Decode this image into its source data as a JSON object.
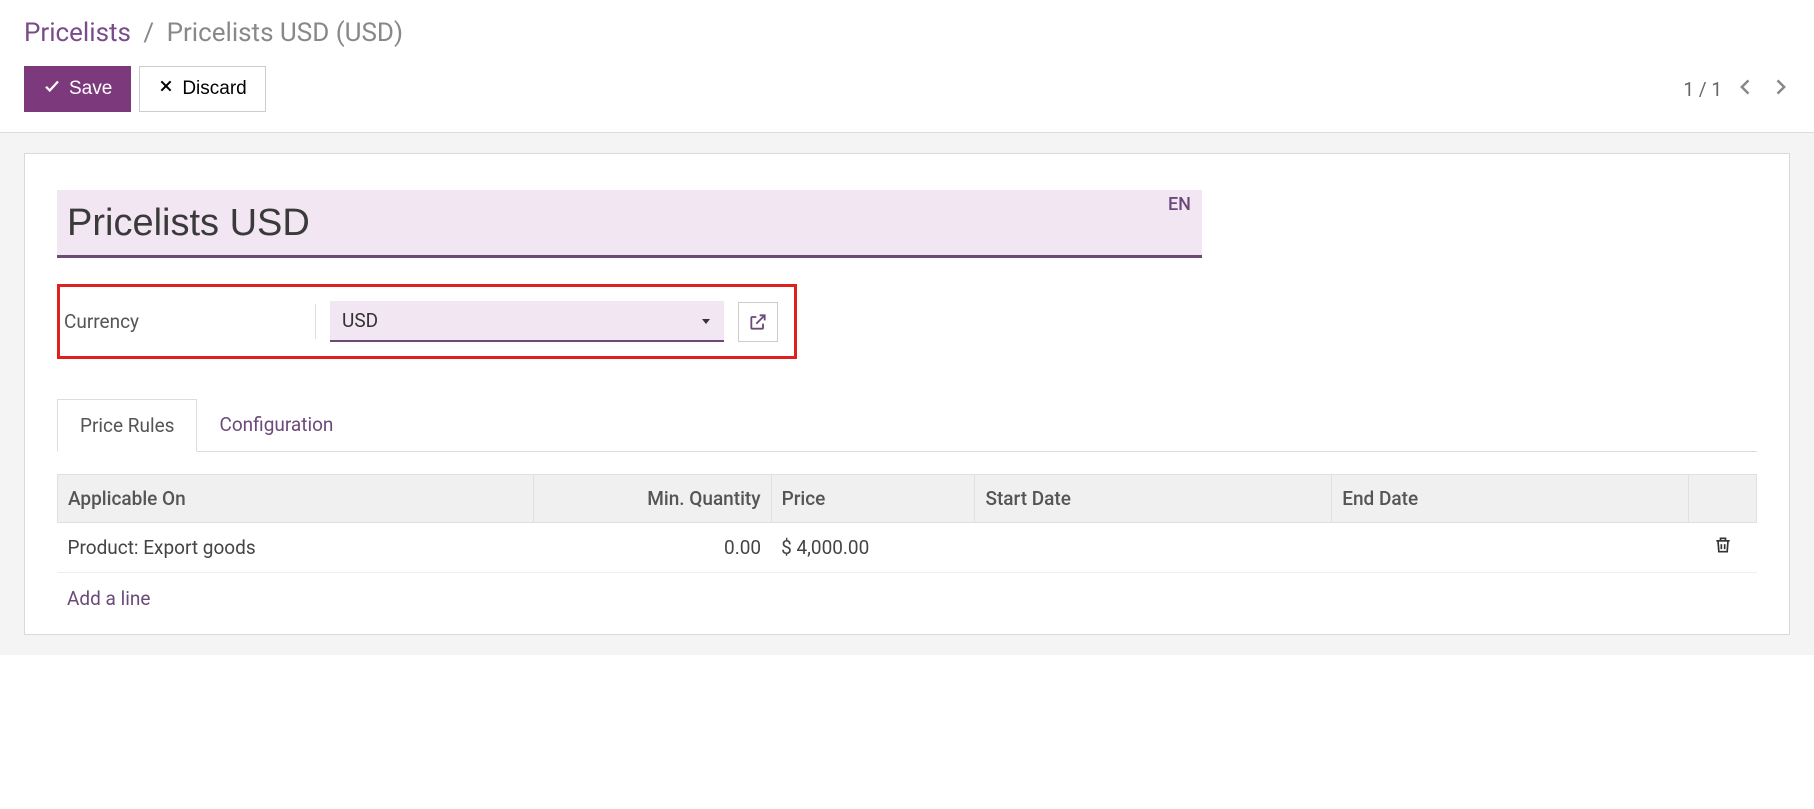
{
  "breadcrumb": {
    "root": "Pricelists",
    "separator": "/",
    "current": "Pricelists USD (USD)"
  },
  "actions": {
    "save": "Save",
    "discard": "Discard"
  },
  "pager": {
    "text": "1 / 1"
  },
  "form": {
    "name_value": "Pricelists USD",
    "lang_badge": "EN",
    "currency": {
      "label": "Currency",
      "value": "USD"
    }
  },
  "tabs": {
    "price_rules": "Price Rules",
    "configuration": "Configuration"
  },
  "table": {
    "headers": {
      "applicable_on": "Applicable On",
      "min_qty": "Min. Quantity",
      "price": "Price",
      "start_date": "Start Date",
      "end_date": "End Date"
    },
    "rows": [
      {
        "applicable_on": "Product: Export goods",
        "min_qty": "0.00",
        "price": "$ 4,000.00",
        "start_date": "",
        "end_date": ""
      }
    ],
    "add_line": "Add a line"
  }
}
